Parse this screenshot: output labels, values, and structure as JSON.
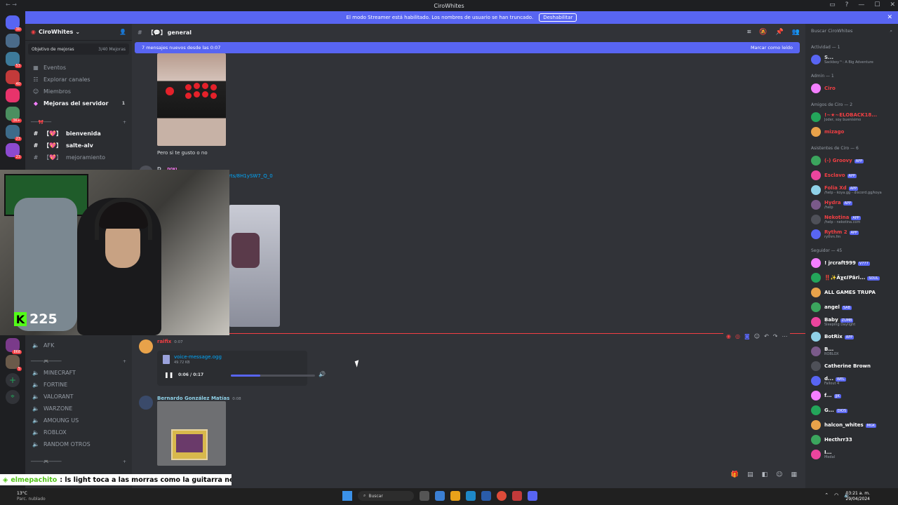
{
  "window": {
    "title": "CiroWhites"
  },
  "streamer_bar": {
    "text": "El modo Streamer está habilitado. Los nombres de usuario se han truncado.",
    "button": "Deshabilitar"
  },
  "guild_badges": [
    "30",
    "23",
    "53",
    "40",
    "36",
    "3K+",
    "23",
    "23",
    "868",
    "5"
  ],
  "server": {
    "name": "CiroWhites",
    "boost": {
      "label": "Objetivo de mejoras",
      "progress": "3/40 Mejoras"
    },
    "nav": [
      {
        "label": "Eventos",
        "icon": "calendar-icon"
      },
      {
        "label": "Explorar canales",
        "icon": "compass-icon"
      },
      {
        "label": "Miembros",
        "icon": "members-icon"
      },
      {
        "label": "Mejoras del servidor",
        "icon": "boost-icon",
        "count": "1"
      }
    ],
    "text_category": "───🎀───",
    "text_channels": [
      {
        "label": "bienvenida",
        "prefix": "【💖】"
      },
      {
        "label": "salte-alv",
        "prefix": "【💖】"
      },
      {
        "label": "mejoramiento",
        "prefix": "【💖】"
      }
    ],
    "afk": "AFK",
    "voice_category": "─────🎮─────",
    "voice_channels": [
      "MINECRAFT",
      "FORTINE",
      "VALORANT",
      "WARZONE",
      "AMOUNG US",
      "ROBLOX",
      "RANDOM OTROS"
    ]
  },
  "chat": {
    "channel": "general",
    "channel_prefix": "【💬】",
    "new_messages": "7 mensajes nuevos desde las 0:07",
    "mark_read": "Marcar como leído",
    "msg1_text": "Pero si te gusto o no",
    "link_text": "rts/8H1ySW7_Q_0",
    "msg2_author": "D",
    "msg2_role": "DOKI",
    "msg3_author": "raifix",
    "msg3_time": "0:07",
    "voice": {
      "filename": "voice-message.ogg",
      "size": "49.72 KB",
      "time": "0:06 / 0:17",
      "progress": 0.35
    },
    "msg4_author": "Bernardo González Matías",
    "msg4_time": "0:08"
  },
  "stream_overlay": {
    "viewers": "225",
    "ticker_user": "elmepachito",
    "ticker_text": ": ls light toca a las morras como la guitarra ne"
  },
  "members": {
    "search_placeholder": "Buscar CiroWhites",
    "groups": [
      {
        "title": "Actividad — 1",
        "items": [
          {
            "name": "S...",
            "sub": "Sackboy™: A Big Adventure",
            "color": "#dbdee1"
          }
        ]
      },
      {
        "title": "Admin — 1",
        "items": [
          {
            "name": "Ciro",
            "color": "#f23f43"
          }
        ]
      },
      {
        "title": "Amigos de Ciro — 2",
        "items": [
          {
            "name": "!~★~ELOBACK18...",
            "sub": "Joder, soy buenísimo",
            "color": "#f23f43"
          },
          {
            "name": "mizago",
            "color": "#f23f43"
          }
        ]
      },
      {
        "title": "Asistentes de Ciro — 6",
        "items": [
          {
            "name": "(-) Groovy",
            "tag": "APP",
            "color": "#f23f43"
          },
          {
            "name": "Esclavo",
            "tag": "APP",
            "color": "#f23f43"
          },
          {
            "name": "Folia Xd",
            "tag": "APP",
            "sub": "/help - koya.gg - discord.gg/koya",
            "color": "#f23f43"
          },
          {
            "name": "Hydra",
            "tag": "APP",
            "sub": "/help",
            "color": "#f23f43"
          },
          {
            "name": "Nekotina",
            "tag": "APP",
            "sub": "/help - nekotina.com",
            "color": "#f23f43"
          },
          {
            "name": "Rythm 2",
            "tag": "APP",
            "sub": "rythm.fm",
            "color": "#f23f43"
          }
        ]
      },
      {
        "title": "Seguidor — 45",
        "items": [
          {
            "name": "! jrcraft999",
            "tag": "V777",
            "color": "#ffffff"
          },
          {
            "name": "‼️✨ÃχєℓPãri...",
            "tag": "SOUL",
            "color": "#ffffff"
          },
          {
            "name": "ALL GAMES TRUPA",
            "color": "#ffffff"
          },
          {
            "name": "angel",
            "tag": "SAB",
            "color": "#ffffff"
          },
          {
            "name": "Baby",
            "tag": "ZUMB",
            "sub": "Sleeping Daylight",
            "color": "#ffffff"
          },
          {
            "name": "BotRix",
            "tag": "APP",
            "color": "#ffffff"
          },
          {
            "name": "B...",
            "sub": "ROBLOX",
            "color": "#ffffff"
          },
          {
            "name": "Catherine Brown",
            "color": "#ffffff"
          },
          {
            "name": "d...",
            "tag": "WEL",
            "sub": "Fallout 4",
            "color": "#ffffff"
          },
          {
            "name": "f...",
            "tag": "JJK",
            "color": "#ffffff"
          },
          {
            "name": "G...",
            "tag": "DIOS",
            "color": "#ffffff"
          },
          {
            "name": "halcon_whites",
            "tag": "MGK",
            "color": "#ffffff"
          },
          {
            "name": "Hecthrr33",
            "color": "#ffffff"
          },
          {
            "name": "I...",
            "sub": "Medal",
            "color": "#ffffff"
          }
        ]
      }
    ]
  },
  "taskbar": {
    "weather_temp": "13°C",
    "weather_desc": "Parc. nublado",
    "search": "Buscar",
    "time": "03:21 a. m.",
    "date": "29/04/2024"
  },
  "colors": {
    "accent": "#5865f2",
    "danger": "#f23f43",
    "kick": "#53fc18"
  }
}
